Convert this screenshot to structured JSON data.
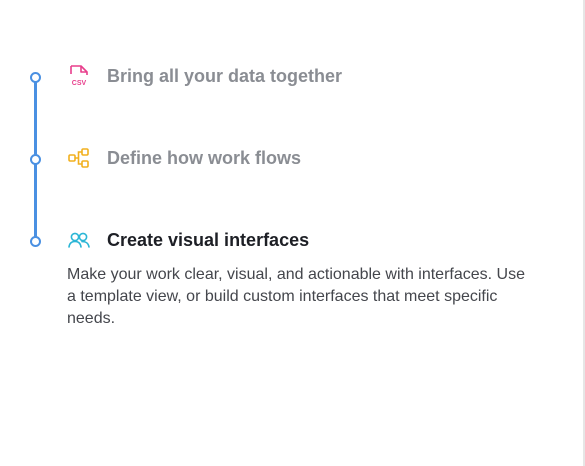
{
  "steps": [
    {
      "title": "Bring all your data together",
      "icon": "csv-file-icon",
      "icon_color": "#e83e8c",
      "icon_text": "CSV",
      "state": "inactive"
    },
    {
      "title": "Define how work flows",
      "icon": "workflow-icon",
      "icon_color": "#f2b01e",
      "state": "inactive"
    },
    {
      "title": "Create visual interfaces",
      "icon": "users-icon",
      "icon_color": "#2bb6d6",
      "state": "active",
      "description": "Make your work clear, visual, and actionable with interfaces. Use a template view, or build custom interfaces that meet specific needs."
    }
  ],
  "colors": {
    "timeline": "#4a90e2",
    "muted_text": "#8a8d93",
    "active_text": "#1d1f25",
    "body_text": "#44464c"
  }
}
